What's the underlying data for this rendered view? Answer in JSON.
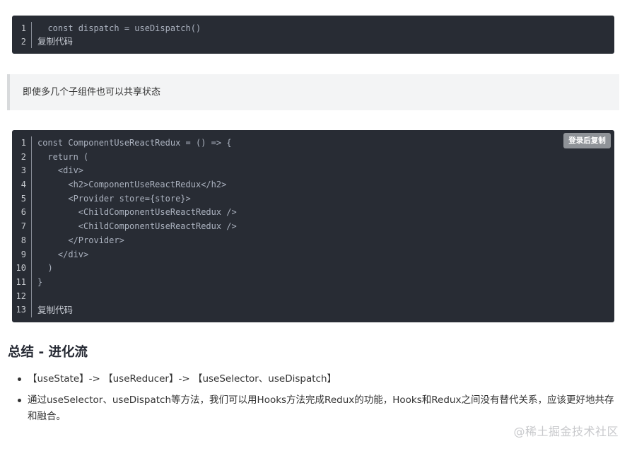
{
  "code_block_1": {
    "lines": [
      {
        "num": "1",
        "text": "  const dispatch = useDispatch()"
      },
      {
        "num": "2",
        "text": "复制代码"
      }
    ]
  },
  "quote": {
    "text": "即使多几个子组件也可以共享状态"
  },
  "code_block_2": {
    "copy_button_label": "登录后复制",
    "lines": [
      {
        "num": "1",
        "text": "const ComponentUseReactRedux = () => {"
      },
      {
        "num": "2",
        "text": "  return ("
      },
      {
        "num": "3",
        "text": "    <div>"
      },
      {
        "num": "4",
        "text": "      <h2>ComponentUseReactRedux</h2>"
      },
      {
        "num": "5",
        "text": "      <Provider store={store}>"
      },
      {
        "num": "6",
        "text": "        <ChildComponentUseReactRedux />"
      },
      {
        "num": "7",
        "text": "        <ChildComponentUseReactRedux />"
      },
      {
        "num": "8",
        "text": "      </Provider>"
      },
      {
        "num": "9",
        "text": "    </div>"
      },
      {
        "num": "10",
        "text": "  )"
      },
      {
        "num": "11",
        "text": "}"
      },
      {
        "num": "12",
        "text": ""
      },
      {
        "num": "13",
        "text": "复制代码"
      }
    ]
  },
  "summary": {
    "heading": "总结 - 进化流",
    "bullets": [
      "【useState】-> 【useReducer】-> 【useSelector、useDispatch】",
      "通过useSelector、useDispatch等方法，我们可以用Hooks方法完成Redux的功能，Hooks和Redux之间没有替代关系，应该更好地共存和融合。"
    ]
  },
  "site_watermark": "@稀土掘金技术社区",
  "colors": {
    "code_background": "#282c34",
    "quote_background": "#f3f4f5",
    "copy_button": "#8f9398"
  }
}
